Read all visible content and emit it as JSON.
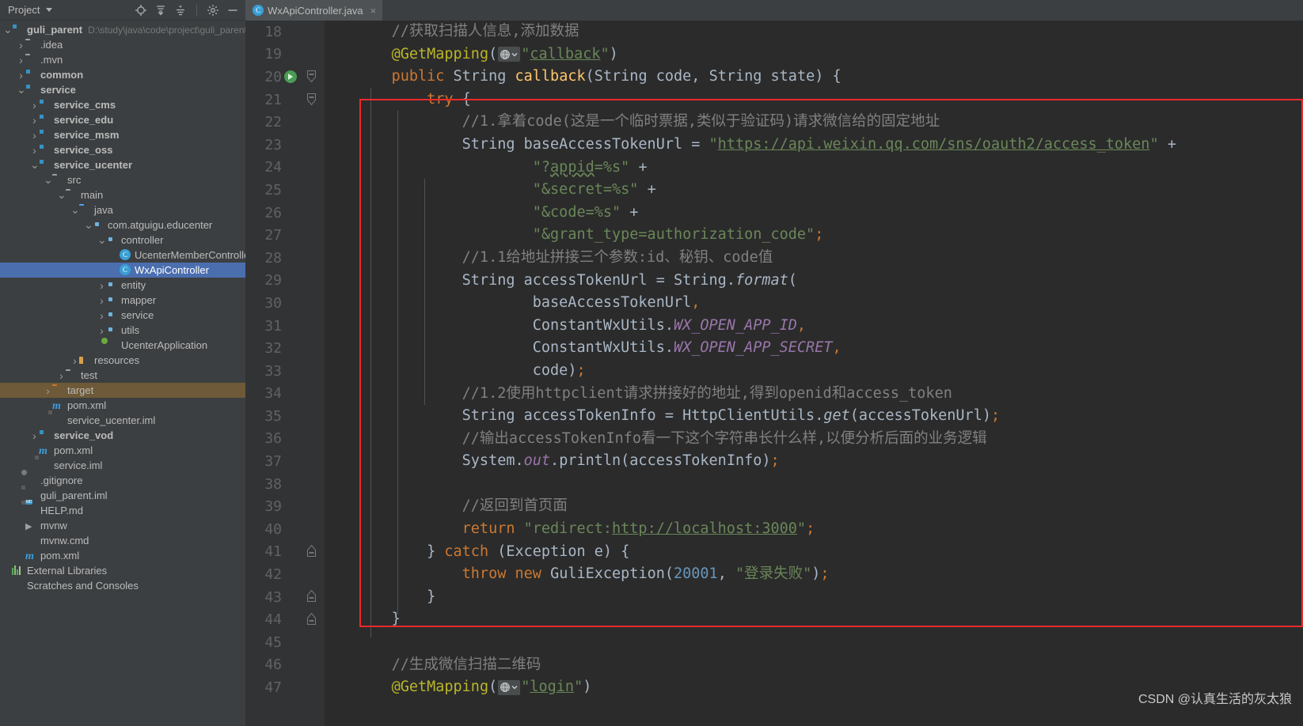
{
  "window": {
    "tool_window_title": "Project",
    "toolbar_icons": [
      "locate-icon",
      "expand-all-icon",
      "collapse-all-icon",
      "settings-gear-icon",
      "minimize-icon"
    ]
  },
  "tabs": [
    {
      "label": "WxApiController.java",
      "icon": "java-class-icon",
      "close": "×",
      "active": true
    }
  ],
  "project_tree": [
    {
      "indent": 0,
      "arrow": "v",
      "icon": "module-folder-icon",
      "label": "guli_parent",
      "bold": true,
      "path": "D:\\study\\java\\code\\project\\guli_parent"
    },
    {
      "indent": 1,
      "arrow": ">",
      "icon": "folder-icon",
      "label": ".idea"
    },
    {
      "indent": 1,
      "arrow": ">",
      "icon": "folder-icon",
      "label": ".mvn"
    },
    {
      "indent": 1,
      "arrow": ">",
      "icon": "module-folder-icon",
      "label": "common",
      "bold": true
    },
    {
      "indent": 1,
      "arrow": "v",
      "icon": "module-folder-icon",
      "label": "service",
      "bold": true
    },
    {
      "indent": 2,
      "arrow": ">",
      "icon": "module-folder-icon",
      "label": "service_cms",
      "bold": true
    },
    {
      "indent": 2,
      "arrow": ">",
      "icon": "module-folder-icon",
      "label": "service_edu",
      "bold": true
    },
    {
      "indent": 2,
      "arrow": ">",
      "icon": "module-folder-icon",
      "label": "service_msm",
      "bold": true
    },
    {
      "indent": 2,
      "arrow": ">",
      "icon": "module-folder-icon",
      "label": "service_oss",
      "bold": true
    },
    {
      "indent": 2,
      "arrow": "v",
      "icon": "module-folder-icon",
      "label": "service_ucenter",
      "bold": true
    },
    {
      "indent": 3,
      "arrow": "v",
      "icon": "folder-icon",
      "label": "src"
    },
    {
      "indent": 4,
      "arrow": "v",
      "icon": "folder-icon",
      "label": "main"
    },
    {
      "indent": 5,
      "arrow": "v",
      "icon": "source-folder-icon",
      "label": "java"
    },
    {
      "indent": 6,
      "arrow": "v",
      "icon": "package-icon",
      "label": "com.atguigu.educenter"
    },
    {
      "indent": 7,
      "arrow": "v",
      "icon": "package-icon",
      "label": "controller"
    },
    {
      "indent": 8,
      "arrow": "",
      "icon": "java-class-icon",
      "label": "UcenterMemberController"
    },
    {
      "indent": 8,
      "arrow": "",
      "icon": "java-class-icon",
      "label": "WxApiController",
      "selected": true
    },
    {
      "indent": 7,
      "arrow": ">",
      "icon": "package-icon",
      "label": "entity"
    },
    {
      "indent": 7,
      "arrow": ">",
      "icon": "package-icon",
      "label": "mapper"
    },
    {
      "indent": 7,
      "arrow": ">",
      "icon": "package-icon",
      "label": "service"
    },
    {
      "indent": 7,
      "arrow": ">",
      "icon": "package-icon",
      "label": "utils"
    },
    {
      "indent": 7,
      "arrow": "",
      "icon": "spring-boot-icon",
      "label": "UcenterApplication"
    },
    {
      "indent": 5,
      "arrow": ">",
      "icon": "resources-folder-icon",
      "label": "resources"
    },
    {
      "indent": 4,
      "arrow": ">",
      "icon": "folder-icon",
      "label": "test"
    },
    {
      "indent": 3,
      "arrow": ">",
      "icon": "excluded-folder-icon",
      "label": "target",
      "target": true
    },
    {
      "indent": 3,
      "arrow": "",
      "icon": "maven-icon",
      "label": "pom.xml"
    },
    {
      "indent": 3,
      "arrow": "",
      "icon": "iml-file-icon",
      "label": "service_ucenter.iml"
    },
    {
      "indent": 2,
      "arrow": ">",
      "icon": "module-folder-icon",
      "label": "service_vod",
      "bold": true
    },
    {
      "indent": 2,
      "arrow": "",
      "icon": "maven-icon",
      "label": "pom.xml"
    },
    {
      "indent": 2,
      "arrow": "",
      "icon": "iml-file-icon",
      "label": "service.iml"
    },
    {
      "indent": 1,
      "arrow": "",
      "icon": "gitignore-icon",
      "label": ".gitignore"
    },
    {
      "indent": 1,
      "arrow": "",
      "icon": "iml-file-icon",
      "label": "guli_parent.iml"
    },
    {
      "indent": 1,
      "arrow": "",
      "icon": "markdown-icon",
      "label": "HELP.md"
    },
    {
      "indent": 1,
      "arrow": "",
      "icon": "shell-script-icon",
      "label": "mvnw"
    },
    {
      "indent": 1,
      "arrow": "",
      "icon": "cmd-script-icon",
      "label": "mvnw.cmd"
    },
    {
      "indent": 1,
      "arrow": "",
      "icon": "maven-icon",
      "label": "pom.xml"
    },
    {
      "indent": 0,
      "arrow": "",
      "icon": "external-libraries-icon",
      "label": "External Libraries"
    },
    {
      "indent": 0,
      "arrow": "",
      "icon": "scratches-icon",
      "label": "Scratches and Consoles"
    }
  ],
  "editor": {
    "first_line_number": 18,
    "lines": [
      {
        "n": 18,
        "gutter": "",
        "fold": ""
      },
      {
        "n": 19,
        "gutter": "",
        "fold": ""
      },
      {
        "n": 20,
        "gutter": "run-gutter-icon",
        "fold": "fold-collapse"
      },
      {
        "n": 21,
        "gutter": "",
        "fold": "fold-collapse"
      },
      {
        "n": 22,
        "gutter": "",
        "fold": ""
      },
      {
        "n": 23,
        "gutter": "",
        "fold": ""
      },
      {
        "n": 24,
        "gutter": "",
        "fold": ""
      },
      {
        "n": 25,
        "gutter": "",
        "fold": ""
      },
      {
        "n": 26,
        "gutter": "",
        "fold": ""
      },
      {
        "n": 27,
        "gutter": "",
        "fold": ""
      },
      {
        "n": 28,
        "gutter": "",
        "fold": ""
      },
      {
        "n": 29,
        "gutter": "",
        "fold": ""
      },
      {
        "n": 30,
        "gutter": "",
        "fold": ""
      },
      {
        "n": 31,
        "gutter": "",
        "fold": ""
      },
      {
        "n": 32,
        "gutter": "",
        "fold": ""
      },
      {
        "n": 33,
        "gutter": "",
        "fold": ""
      },
      {
        "n": 34,
        "gutter": "",
        "fold": ""
      },
      {
        "n": 35,
        "gutter": "",
        "fold": ""
      },
      {
        "n": 36,
        "gutter": "",
        "fold": ""
      },
      {
        "n": 37,
        "gutter": "",
        "fold": ""
      },
      {
        "n": 38,
        "gutter": "",
        "fold": ""
      },
      {
        "n": 39,
        "gutter": "",
        "fold": ""
      },
      {
        "n": 40,
        "gutter": "",
        "fold": ""
      },
      {
        "n": 41,
        "gutter": "",
        "fold": "fold-end"
      },
      {
        "n": 42,
        "gutter": "",
        "fold": ""
      },
      {
        "n": 43,
        "gutter": "",
        "fold": "fold-end"
      },
      {
        "n": 44,
        "gutter": "",
        "fold": "fold-end"
      },
      {
        "n": 45,
        "gutter": "",
        "fold": ""
      },
      {
        "n": 46,
        "gutter": "",
        "fold": ""
      },
      {
        "n": 47,
        "gutter": "",
        "fold": ""
      }
    ],
    "code_text": [
      "    //获取扫描人信息,添加数据",
      "    @GetMapping(\"callback\")",
      "    public String callback(String code, String state) {",
      "        try {",
      "            //1.拿着code(这是一个临时票据,类似于验证码)请求微信给的固定地址",
      "            String baseAccessTokenUrl = \"https://api.weixin.qq.com/sns/oauth2/access_token\" +",
      "                    \"?appid=%s\" +",
      "                    \"&secret=%s\" +",
      "                    \"&code=%s\" +",
      "                    \"&grant_type=authorization_code\";",
      "            //1.1给地址拼接三个参数:id、秘钥、code值",
      "            String accessTokenUrl = String.format(",
      "                    baseAccessTokenUrl,",
      "                    ConstantWxUtils.WX_OPEN_APP_ID,",
      "                    ConstantWxUtils.WX_OPEN_APP_SECRET,",
      "                    code);",
      "            //1.2使用httpclient请求拼接好的地址,得到openid和access_token",
      "            String accessTokenInfo = HttpClientUtils.get(accessTokenUrl);",
      "            //输出accessTokenInfo看一下这个字符串长什么样,以便分析后面的业务逻辑",
      "            System.out.println(accessTokenInfo);",
      "",
      "            //返回到首页面",
      "            return \"redirect:http://localhost:3000\";",
      "        } catch (Exception e) {",
      "            throw new GuliException(20001, \"登录失败\");",
      "        }",
      "    }",
      "",
      "    //生成微信扫描二维码",
      "    @GetMapping(\"login\")"
    ]
  },
  "annotation": {
    "red_box": {
      "color": "#ef2929",
      "label": "highlight-rectangle"
    }
  },
  "watermark": {
    "text": "CSDN @认真生活的灰太狼"
  },
  "colors": {
    "editor_bg": "#2b2b2b",
    "gutter_bg": "#313335",
    "panel_bg": "#3c3f41",
    "selection_blue": "#4b6eaf",
    "target_brown": "#6e5a38",
    "keyword_orange": "#cc7832",
    "string_green": "#6a8759",
    "comment_gray": "#808080",
    "annotation_yellow": "#bbb529",
    "number_blue": "#6897bb",
    "static_purple": "#9876aa",
    "method_yellow": "#ffc66d",
    "text_default": "#a9b7c6"
  }
}
